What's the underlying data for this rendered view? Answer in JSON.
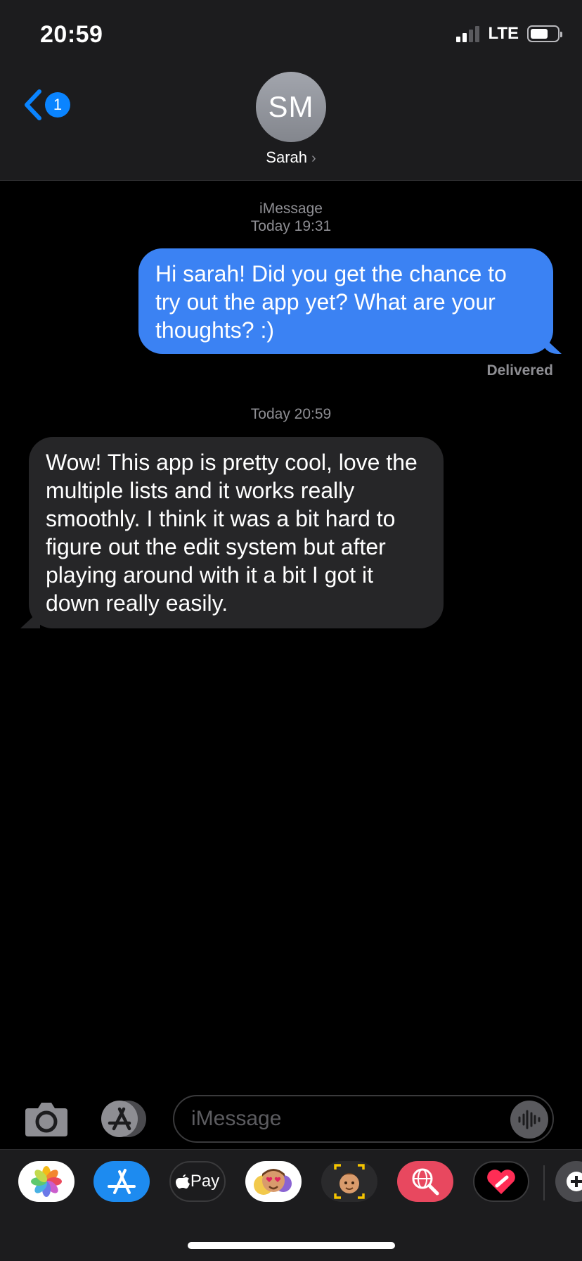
{
  "status_bar": {
    "time": "20:59",
    "network": "LTE",
    "signal_bars_active": 2,
    "signal_bars_total": 4,
    "battery_level": 0.6
  },
  "header": {
    "back_badge": "1",
    "avatar_initials": "SM",
    "contact_name": "Sarah",
    "contact_chevron": "›"
  },
  "conversation": {
    "service_label": "iMessage",
    "first_timestamp": "Today 19:31",
    "messages": [
      {
        "direction": "sent",
        "text": "Hi sarah! Did you get the chance to try out the app yet? What are your thoughts? :)",
        "status": "Delivered"
      },
      {
        "direction": "received",
        "timestamp": "Today 20:59",
        "text": "Wow! This app is pretty cool, love the multiple lists and it works really smoothly. I think it was a bit hard to figure out the edit system but after playing around with it a bit I got it down really easily."
      }
    ]
  },
  "composer": {
    "placeholder": "iMessage",
    "icons": [
      "camera-icon",
      "app-store-icon",
      "audio-waveform-icon"
    ]
  },
  "app_drawer": {
    "apps": [
      {
        "name": "photos-app-icon"
      },
      {
        "name": "app-store-app-icon"
      },
      {
        "name": "apple-pay-app-icon",
        "label": "Pay"
      },
      {
        "name": "memoji-stickers-app-icon"
      },
      {
        "name": "animoji-app-icon"
      },
      {
        "name": "web-images-search-app-icon"
      },
      {
        "name": "digital-touch-app-icon"
      },
      {
        "name": "more-apps-icon"
      }
    ]
  },
  "colors": {
    "sent_bubble": "#3b82f3",
    "received_bubble": "#262628",
    "header_bg": "#1c1c1e",
    "accent": "#0a84ff",
    "meta_text": "#8e8e93"
  }
}
